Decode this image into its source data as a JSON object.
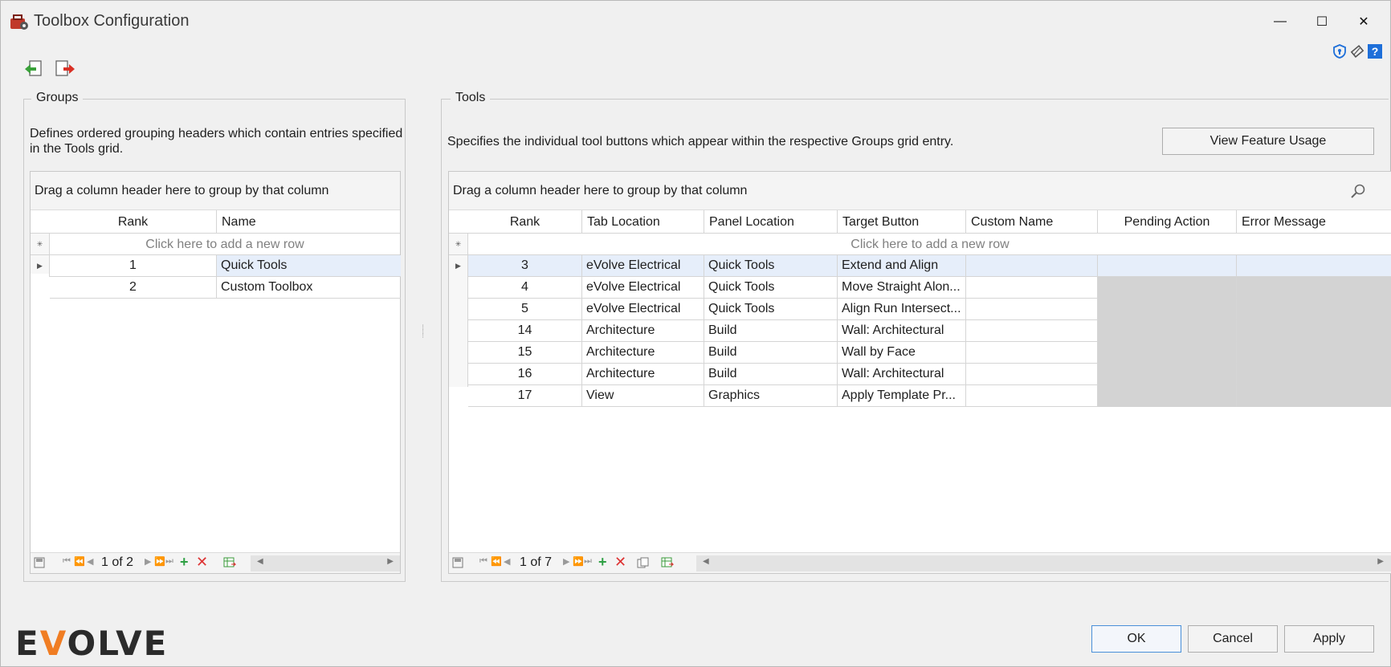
{
  "window": {
    "title": "Toolbox Configuration",
    "controls": {
      "minimize": "—",
      "maximize": "☐",
      "close": "✕"
    }
  },
  "header_icons": [
    "shield-icon",
    "eraser-icon",
    "help-icon"
  ],
  "toolbar": [
    "import-icon",
    "export-icon"
  ],
  "groups": {
    "caption": "Groups",
    "description": "Defines ordered grouping headers which contain entries specified in the Tools grid.",
    "group_panel_hint": "Drag a column header here to group by that column",
    "columns": [
      "Rank",
      "Name"
    ],
    "new_row_text": "Click here to add a new row",
    "rows": [
      {
        "rank": "1",
        "name": "Quick Tools"
      },
      {
        "rank": "2",
        "name": "Custom Toolbox"
      }
    ],
    "pager": "1 of 2"
  },
  "tools": {
    "caption": "Tools",
    "description": "Specifies the individual tool buttons which appear within the respective Groups grid entry.",
    "view_feature_usage_label": "View Feature Usage",
    "group_panel_hint": "Drag a column header here to group by that column",
    "columns": [
      "Rank",
      "Tab Location",
      "Panel Location",
      "Target Button",
      "Custom Name",
      "Pending Action",
      "Error Message"
    ],
    "new_row_text": "Click here to add a new row",
    "rows": [
      {
        "rank": "3",
        "tab": "eVolve Electrical",
        "panel": "Quick Tools",
        "target": "Extend and Align",
        "custom": "",
        "pending": "",
        "error": ""
      },
      {
        "rank": "4",
        "tab": "eVolve Electrical",
        "panel": "Quick Tools",
        "target": "Move Straight Alon...",
        "custom": "",
        "pending": "",
        "error": ""
      },
      {
        "rank": "5",
        "tab": "eVolve Electrical",
        "panel": "Quick Tools",
        "target": "Align Run Intersect...",
        "custom": "",
        "pending": "",
        "error": ""
      },
      {
        "rank": "14",
        "tab": "Architecture",
        "panel": "Build",
        "target": "Wall: Architectural",
        "custom": "",
        "pending": "",
        "error": ""
      },
      {
        "rank": "15",
        "tab": "Architecture",
        "panel": "Build",
        "target": "Wall by Face",
        "custom": "",
        "pending": "",
        "error": ""
      },
      {
        "rank": "16",
        "tab": "Architecture",
        "panel": "Build",
        "target": "Wall: Architectural",
        "custom": "",
        "pending": "",
        "error": ""
      },
      {
        "rank": "17",
        "tab": "View",
        "panel": "Graphics",
        "target": "Apply Template Pr...",
        "custom": "",
        "pending": "",
        "error": ""
      }
    ],
    "pager": "1 of 7"
  },
  "buttons": {
    "ok": "OK",
    "cancel": "Cancel",
    "apply": "Apply"
  },
  "logo": {
    "text_pre": "E",
    "text_v": "V",
    "text_post": "OLVE"
  },
  "colors": {
    "selected_row": "#e6eefa",
    "readonly_cell": "#d3d3d3",
    "logo_accent": "#f07d23",
    "primary_border": "#4a90d9"
  }
}
